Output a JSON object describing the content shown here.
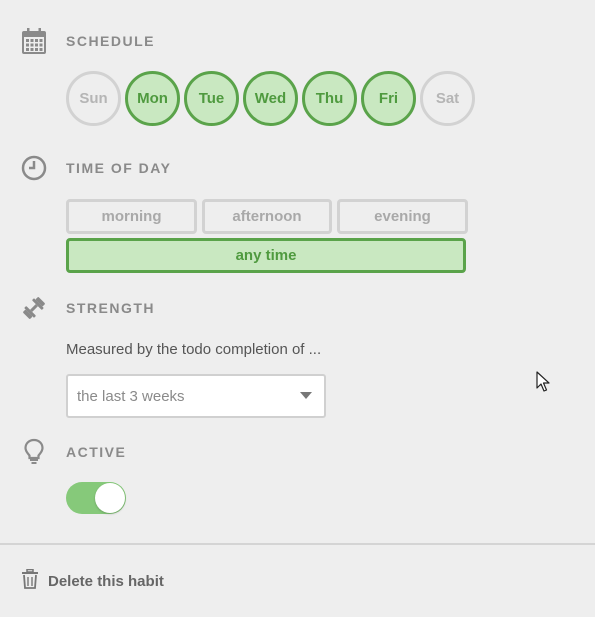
{
  "schedule": {
    "title": "SCHEDULE",
    "icon": "calendar-icon",
    "days": [
      {
        "label": "Sun",
        "on": false
      },
      {
        "label": "Mon",
        "on": true
      },
      {
        "label": "Tue",
        "on": true
      },
      {
        "label": "Wed",
        "on": true
      },
      {
        "label": "Thu",
        "on": true
      },
      {
        "label": "Fri",
        "on": true
      },
      {
        "label": "Sat",
        "on": false
      }
    ]
  },
  "time_of_day": {
    "title": "TIME OF DAY",
    "icon": "clock-icon",
    "options": [
      "morning",
      "afternoon",
      "evening"
    ],
    "any_label": "any time",
    "selected": "any time"
  },
  "strength": {
    "title": "STRENGTH",
    "icon": "dumbbell-icon",
    "description": "Measured by the todo completion of ...",
    "select_value": "the last 3 weeks"
  },
  "active": {
    "title": "ACTIVE",
    "icon": "lightbulb-icon",
    "enabled": true
  },
  "footer": {
    "delete_label": "Delete this habit",
    "icon": "trash-icon"
  },
  "colors": {
    "selected_green": "#5aa34a",
    "selected_fill": "#c9e8c1",
    "toggle_on": "#86c97a",
    "background": "#eeeeee"
  }
}
